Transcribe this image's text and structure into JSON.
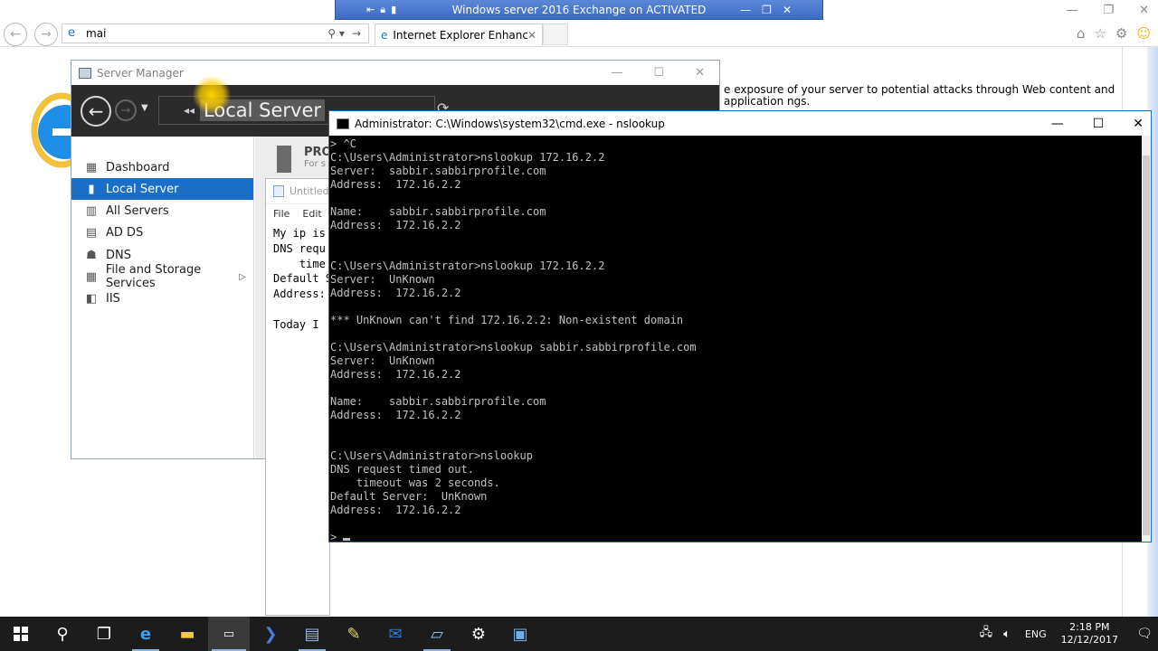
{
  "rdp": {
    "title": "Windows server 2016 Exchange on ACTIVATED"
  },
  "ie": {
    "address": "mai",
    "tab_label": "Internet Explorer Enhanced ...",
    "page_text": "e exposure of your server to potential attacks through Web content and application ngs."
  },
  "server_manager": {
    "window_title": "Server Manager",
    "breadcrumb": "Local Server",
    "sidebar": [
      {
        "label": "Dashboard",
        "icon": "dashboard-icon"
      },
      {
        "label": "Local Server",
        "icon": "server-icon",
        "active": true
      },
      {
        "label": "All Servers",
        "icon": "servers-icon"
      },
      {
        "label": "AD DS",
        "icon": "ad-ds-icon"
      },
      {
        "label": "DNS",
        "icon": "dns-icon"
      },
      {
        "label": "File and Storage Services",
        "icon": "storage-icon",
        "has_arrow": true
      },
      {
        "label": "IIS",
        "icon": "iis-icon"
      }
    ],
    "properties_title": "PRO",
    "properties_sub": "For s"
  },
  "notepad": {
    "title": "Untitled",
    "menu": [
      "File",
      "Edit"
    ],
    "body": "My ip is\nDNS requ\n    time\nDefault S\nAddress:\n\nToday I"
  },
  "cmd": {
    "title": "Administrator: C:\\Windows\\system32\\cmd.exe - nslookup",
    "output": "> ^C\nC:\\Users\\Administrator>nslookup 172.16.2.2\nServer:  sabbir.sabbirprofile.com\nAddress:  172.16.2.2\n\nName:    sabbir.sabbirprofile.com\nAddress:  172.16.2.2\n\n\nC:\\Users\\Administrator>nslookup 172.16.2.2\nServer:  UnKnown\nAddress:  172.16.2.2\n\n*** UnKnown can't find 172.16.2.2: Non-existent domain\n\nC:\\Users\\Administrator>nslookup sabbir.sabbirprofile.com\nServer:  UnKnown\nAddress:  172.16.2.2\n\nName:    sabbir.sabbirprofile.com\nAddress:  172.16.2.2\n\n\nC:\\Users\\Administrator>nslookup\nDNS request timed out.\n    timeout was 2 seconds.\nDefault Server:  UnKnown\nAddress:  172.16.2.2\n\n> "
  },
  "taskbar": {
    "lang": "ENG",
    "time": "2:18 PM",
    "date": "12/12/2017"
  }
}
